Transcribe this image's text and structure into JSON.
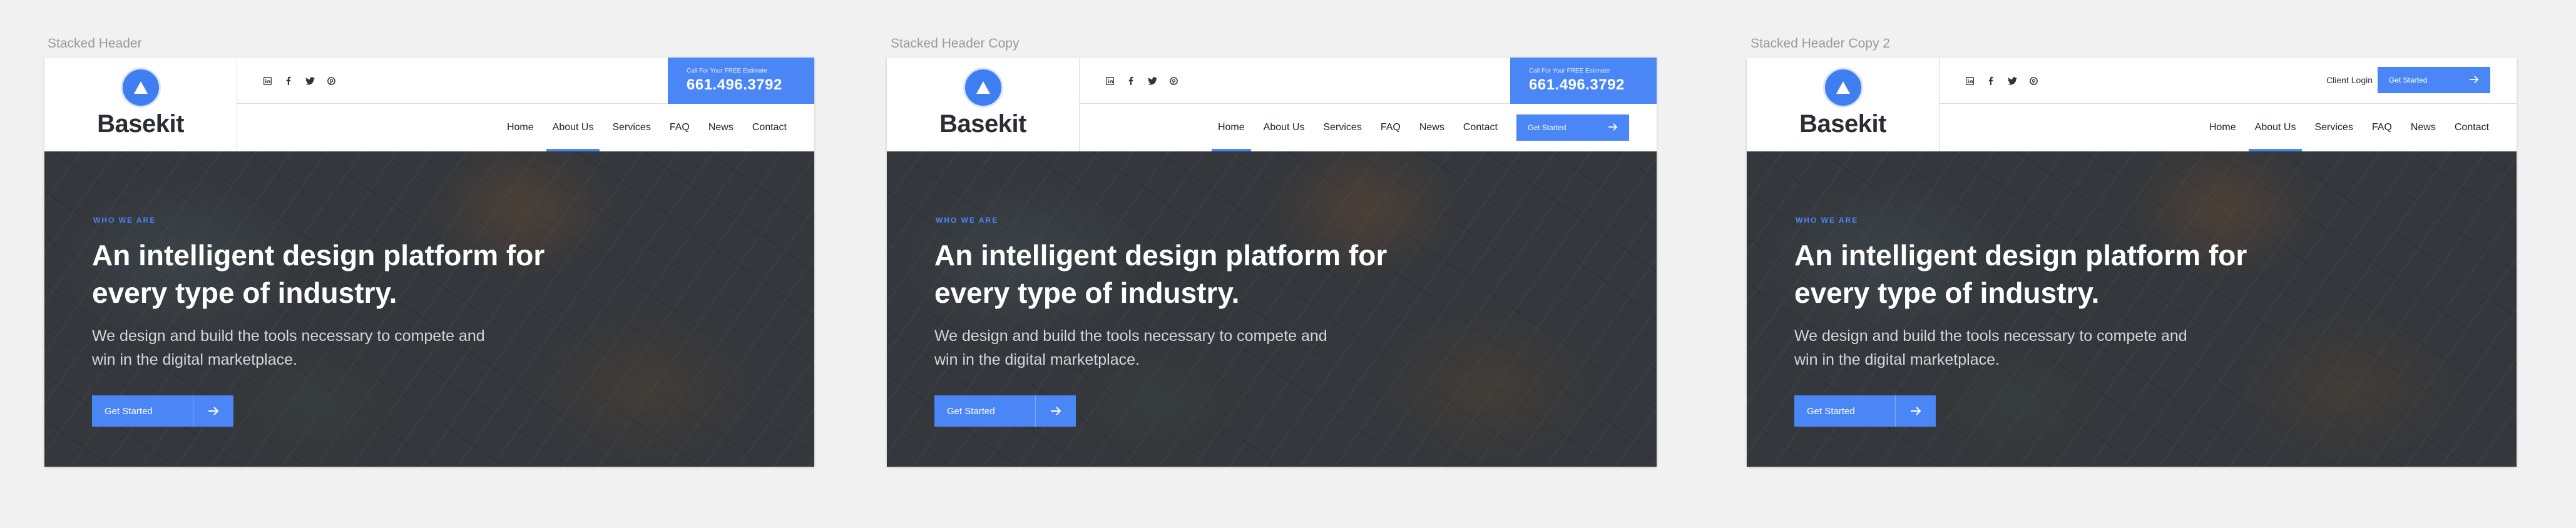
{
  "artboards": [
    {
      "title": "Stacked Header",
      "variant": "phone",
      "active_nav": "About Us"
    },
    {
      "title": "Stacked Header Copy",
      "variant": "phone-navcta",
      "active_nav": "Home"
    },
    {
      "title": "Stacked Header Copy 2",
      "variant": "login",
      "active_nav": "About Us"
    }
  ],
  "brand": {
    "name": "Basekit",
    "accent": "#4a86f5"
  },
  "social_icons": [
    "linkedin-icon",
    "facebook-icon",
    "twitter-icon",
    "pinterest-icon"
  ],
  "phone": {
    "label": "Call For Your FREE Estimate",
    "number": "661.496.3792"
  },
  "client_login": "Client Login",
  "nav": {
    "items": [
      "Home",
      "About Us",
      "Services",
      "FAQ",
      "News",
      "Contact"
    ],
    "cta_label": "Get Started"
  },
  "hero": {
    "eyebrow": "WHO WE ARE",
    "headline": "An intelligent design platform for every type of industry.",
    "subhead": "We design and build the tools necessary to compete and win in the digital marketplace.",
    "cta_label": "Get Started"
  }
}
